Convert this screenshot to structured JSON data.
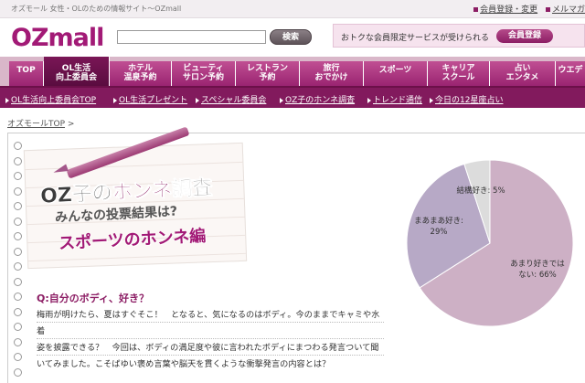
{
  "header": {
    "tagline": "オズモール 女性・OLのための情報サイト～OZmall",
    "links": [
      "会員登録・変更",
      "メルマガ"
    ],
    "logo": "OZmall",
    "search_button": "検索",
    "promo_text": "おトクな会員限定サービスが受けられる",
    "promo_button": "会員登録"
  },
  "nav": [
    {
      "l1": "TOP",
      "l2": ""
    },
    {
      "l1": "OL生活",
      "l2": "向上委員会"
    },
    {
      "l1": "ホテル",
      "l2": "温泉予約"
    },
    {
      "l1": "ビューティ",
      "l2": "サロン予約"
    },
    {
      "l1": "レストラン",
      "l2": "予約"
    },
    {
      "l1": "旅行",
      "l2": "おでかけ"
    },
    {
      "l1": "スポーツ",
      "l2": ""
    },
    {
      "l1": "キャリア",
      "l2": "スクール"
    },
    {
      "l1": "占い",
      "l2": "エンタメ"
    },
    {
      "l1": "ウエデ",
      "l2": ""
    }
  ],
  "subnav": [
    "OL生活向上委員会TOP",
    "OL生活プレゼント",
    "スペシャル委員会",
    "OZ子のホンネ調査",
    "トレンド通信",
    "今日の12星座占い"
  ],
  "breadcrumb": "オズモールTOP",
  "feature": {
    "title_a": "OZ子の",
    "title_b": "ホンネ",
    "title_c": "調査",
    "subtitle": "みんなの投票結果は?",
    "category": "スポーツのホンネ編"
  },
  "question": "Q:自分のボディ、好き？",
  "body_lines": [
    "梅雨が明けたら、夏はすぐそこ！　となると、気になるのはボディ。今のままでキャミや水着",
    "姿を披露できる？　今回は、ボディの満足度や彼に言われたボディにまつわる発言ついて聞",
    "いてみました。こそばゆい褒め言葉や脳天を貫くような衝撃発言の内容とは？"
  ],
  "chart_data": {
    "type": "pie",
    "slices": [
      {
        "label": "あまり好きではない",
        "value": 66,
        "color": "#cdb0c5"
      },
      {
        "label": "まあまあ好き",
        "value": 29,
        "color": "#b7a9c6"
      },
      {
        "label": "結構好き",
        "value": 5,
        "color": "#dcdcdc"
      }
    ],
    "label_texts": [
      "あまり好きではない: 66%",
      "まあまあ好き: 29%",
      "結構好き: 5%"
    ]
  }
}
